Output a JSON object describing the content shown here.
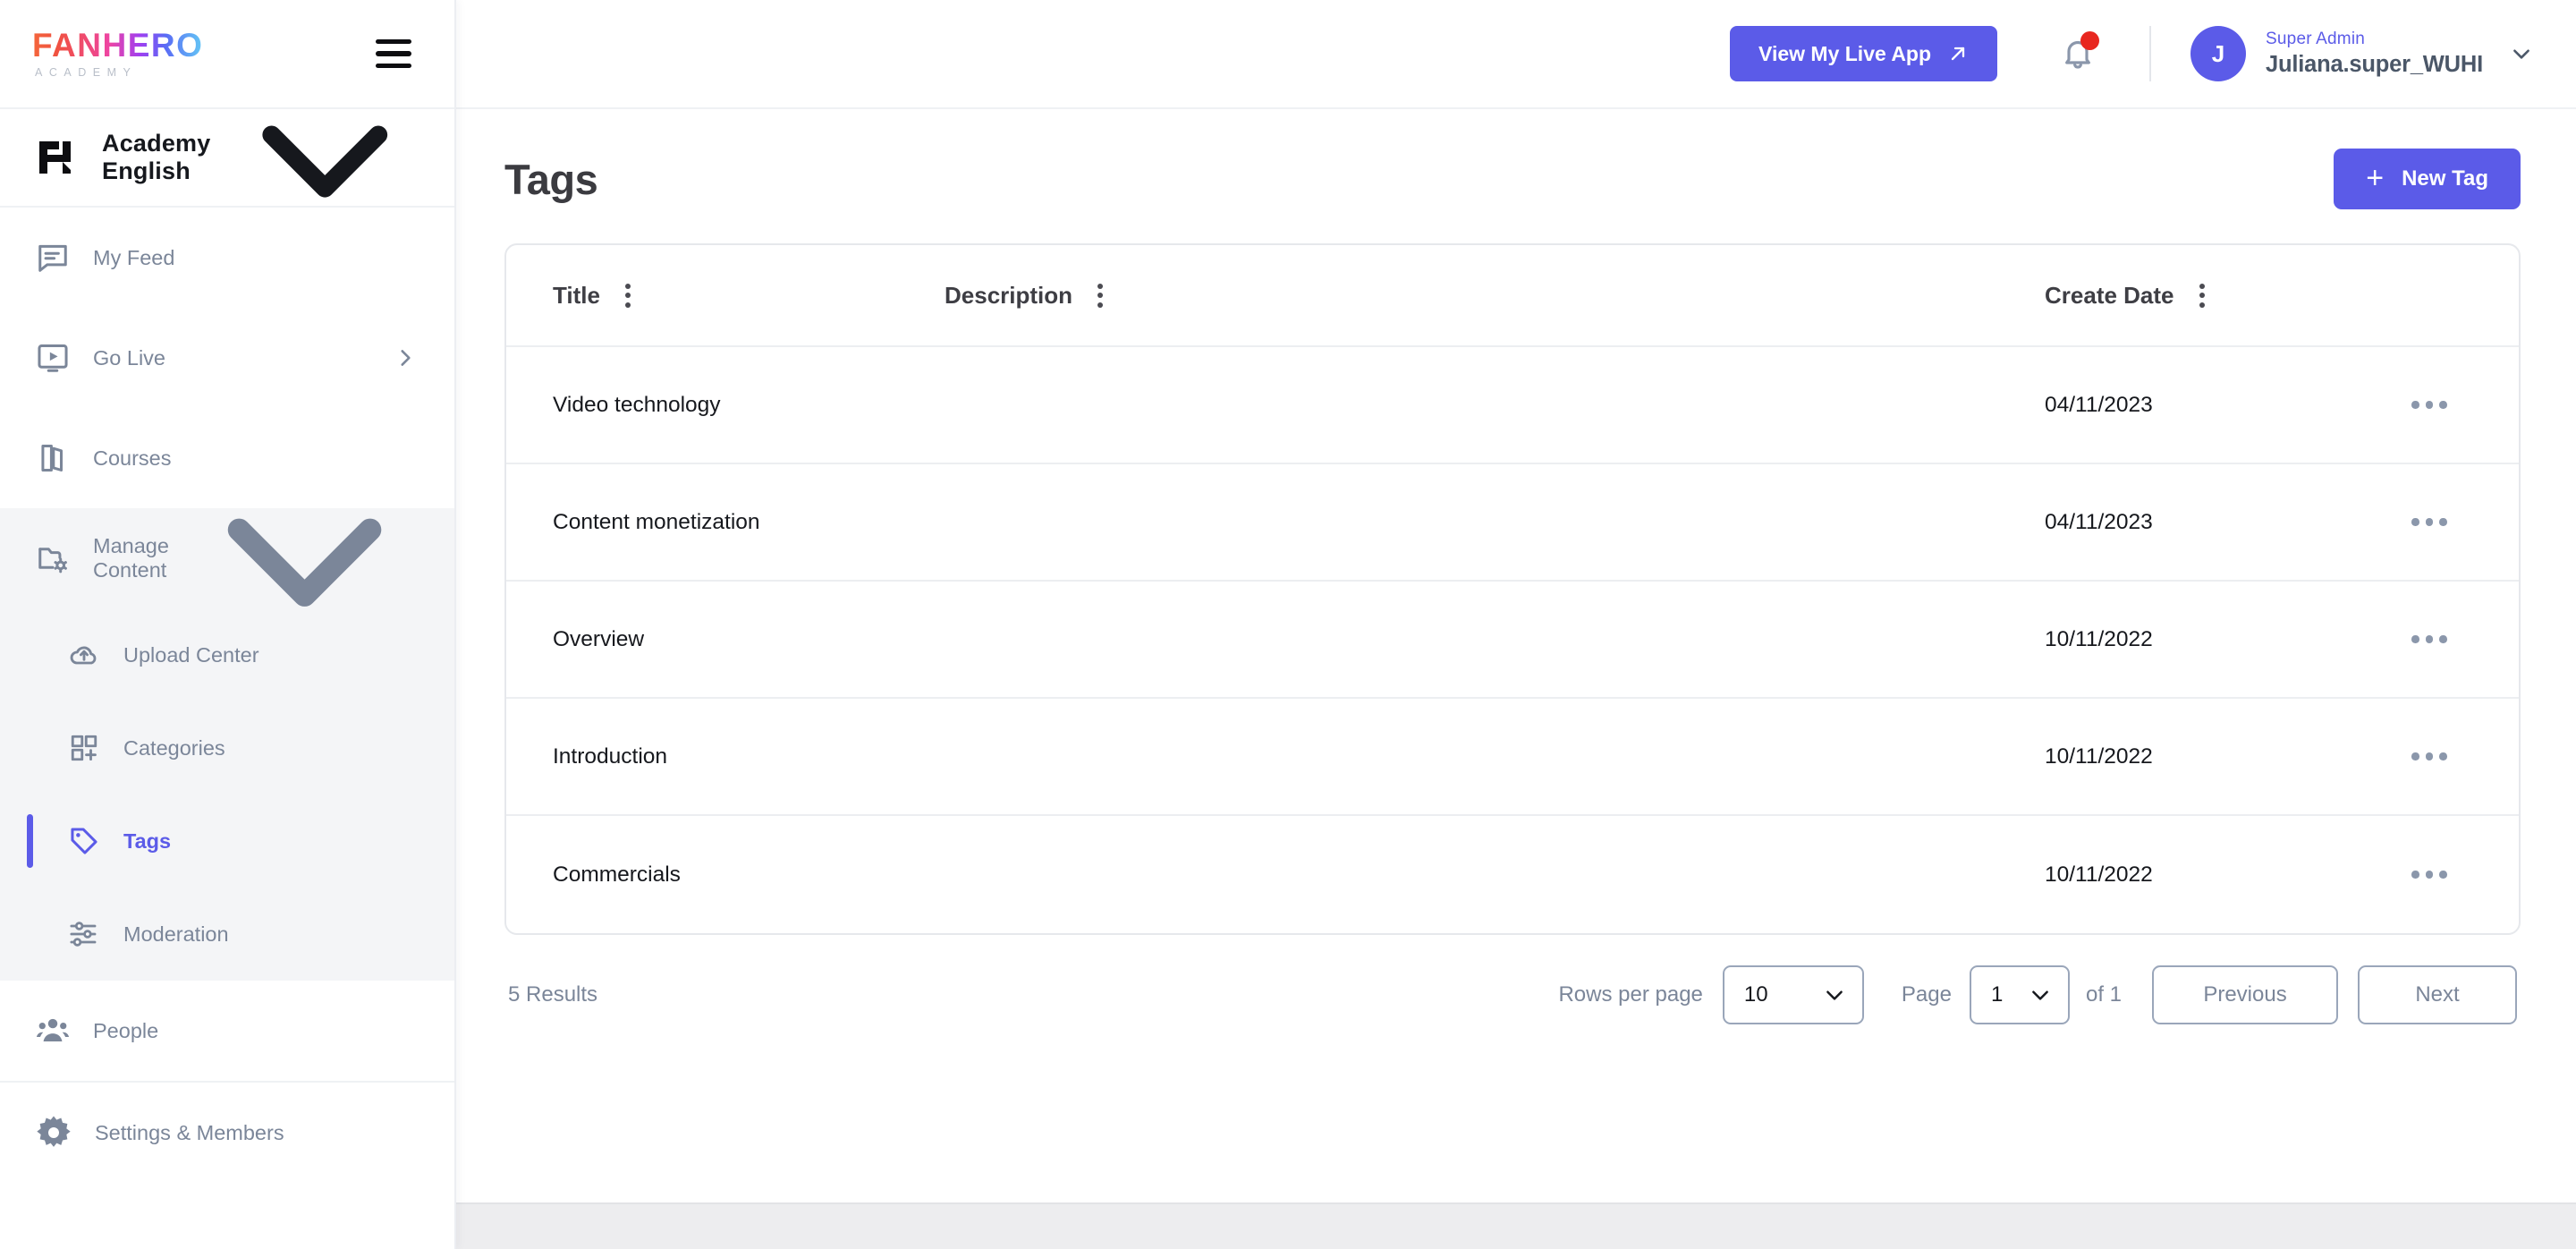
{
  "brand": {
    "logo_word": "FANHERO",
    "logo_sub": "ACADEMY",
    "hamburger_icon": "hamburger-menu-icon"
  },
  "workspace": {
    "name": "Academy English",
    "chevron_icon": "chevron-down-icon"
  },
  "sidebar": {
    "items": [
      {
        "label": "My Feed",
        "icon": "feed-icon"
      },
      {
        "label": "Go Live",
        "icon": "live-video-icon",
        "chevron": "chevron-right-icon"
      },
      {
        "label": "Courses",
        "icon": "book-icon"
      }
    ],
    "group": {
      "label": "Manage Content",
      "icon": "folder-settings-icon",
      "chevron": "chevron-down-icon",
      "items": [
        {
          "label": "Upload Center",
          "icon": "cloud-upload-icon",
          "active": false
        },
        {
          "label": "Categories",
          "icon": "grid-plus-icon",
          "active": false
        },
        {
          "label": "Tags",
          "icon": "tag-icon",
          "active": true
        },
        {
          "label": "Moderation",
          "icon": "sliders-icon",
          "active": false
        }
      ]
    },
    "people": {
      "label": "People",
      "icon": "people-icon"
    },
    "settings": {
      "label": "Settings & Members",
      "icon": "gear-icon"
    }
  },
  "topbar": {
    "live_app_label": "View My Live App",
    "live_app_icon": "arrow-up-right-icon",
    "bell_icon": "bell-icon",
    "has_notification": true,
    "avatar_initial": "J",
    "user_role": "Super Admin",
    "user_name": "Juliana.super_WUHI",
    "user_chevron_icon": "chevron-down-icon"
  },
  "page": {
    "title": "Tags",
    "new_button_label": "New Tag",
    "new_button_icon": "plus-icon"
  },
  "table": {
    "columns": [
      {
        "label": "Title",
        "menu_icon": "column-menu-icon"
      },
      {
        "label": "Description",
        "menu_icon": "column-menu-icon"
      },
      {
        "label": "Create Date",
        "menu_icon": "column-menu-icon"
      }
    ],
    "rows": [
      {
        "title": "Video technology",
        "description": "",
        "date": "04/11/2023",
        "actions_icon": "row-actions-icon"
      },
      {
        "title": "Content monetization",
        "description": "",
        "date": "04/11/2023",
        "actions_icon": "row-actions-icon"
      },
      {
        "title": "Overview",
        "description": "",
        "date": "10/11/2022",
        "actions_icon": "row-actions-icon"
      },
      {
        "title": "Introduction",
        "description": "",
        "date": "10/11/2022",
        "actions_icon": "row-actions-icon"
      },
      {
        "title": "Commercials",
        "description": "",
        "date": "10/11/2022",
        "actions_icon": "row-actions-icon"
      }
    ]
  },
  "pagination": {
    "results_label": "5 Results",
    "rows_per_page_label": "Rows per page",
    "rows_per_page_value": "10",
    "page_label": "Page",
    "page_value": "1",
    "of_label": "of 1",
    "previous_label": "Previous",
    "next_label": "Next",
    "chevron_icon": "chevron-down-icon"
  },
  "colors": {
    "accent": "#5B5BE8",
    "muted_text": "#7B8699",
    "notification_dot": "#E8271F",
    "body_text": "#16181D"
  }
}
